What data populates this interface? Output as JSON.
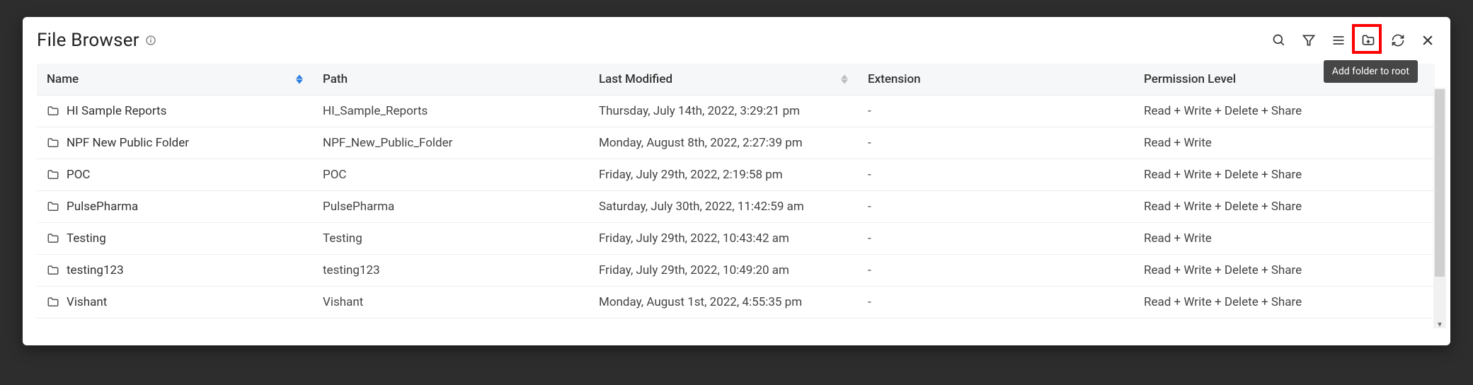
{
  "header": {
    "title": "File Browser"
  },
  "tooltip": {
    "add_folder": "Add folder to root"
  },
  "columns": {
    "name": "Name",
    "path": "Path",
    "last_modified": "Last Modified",
    "extension": "Extension",
    "permission": "Permission Level"
  },
  "rows": [
    {
      "name": "HI Sample Reports",
      "path": "HI_Sample_Reports",
      "last_modified": "Thursday, July 14th, 2022, 3:29:21 pm",
      "extension": "-",
      "permission": "Read + Write + Delete + Share"
    },
    {
      "name": "NPF New Public Folder",
      "path": "NPF_New_Public_Folder",
      "last_modified": "Monday, August 8th, 2022, 2:27:39 pm",
      "extension": "-",
      "permission": "Read + Write"
    },
    {
      "name": "POC",
      "path": "POC",
      "last_modified": "Friday, July 29th, 2022, 2:19:58 pm",
      "extension": "-",
      "permission": "Read + Write + Delete + Share"
    },
    {
      "name": "PulsePharma",
      "path": "PulsePharma",
      "last_modified": "Saturday, July 30th, 2022, 11:42:59 am",
      "extension": "-",
      "permission": "Read + Write + Delete + Share"
    },
    {
      "name": "Testing",
      "path": "Testing",
      "last_modified": "Friday, July 29th, 2022, 10:43:42 am",
      "extension": "-",
      "permission": "Read + Write"
    },
    {
      "name": "testing123",
      "path": "testing123",
      "last_modified": "Friday, July 29th, 2022, 10:49:20 am",
      "extension": "-",
      "permission": "Read + Write + Delete + Share"
    },
    {
      "name": "Vishant",
      "path": "Vishant",
      "last_modified": "Monday, August 1st, 2022, 4:55:35 pm",
      "extension": "-",
      "permission": "Read + Write + Delete + Share"
    }
  ]
}
